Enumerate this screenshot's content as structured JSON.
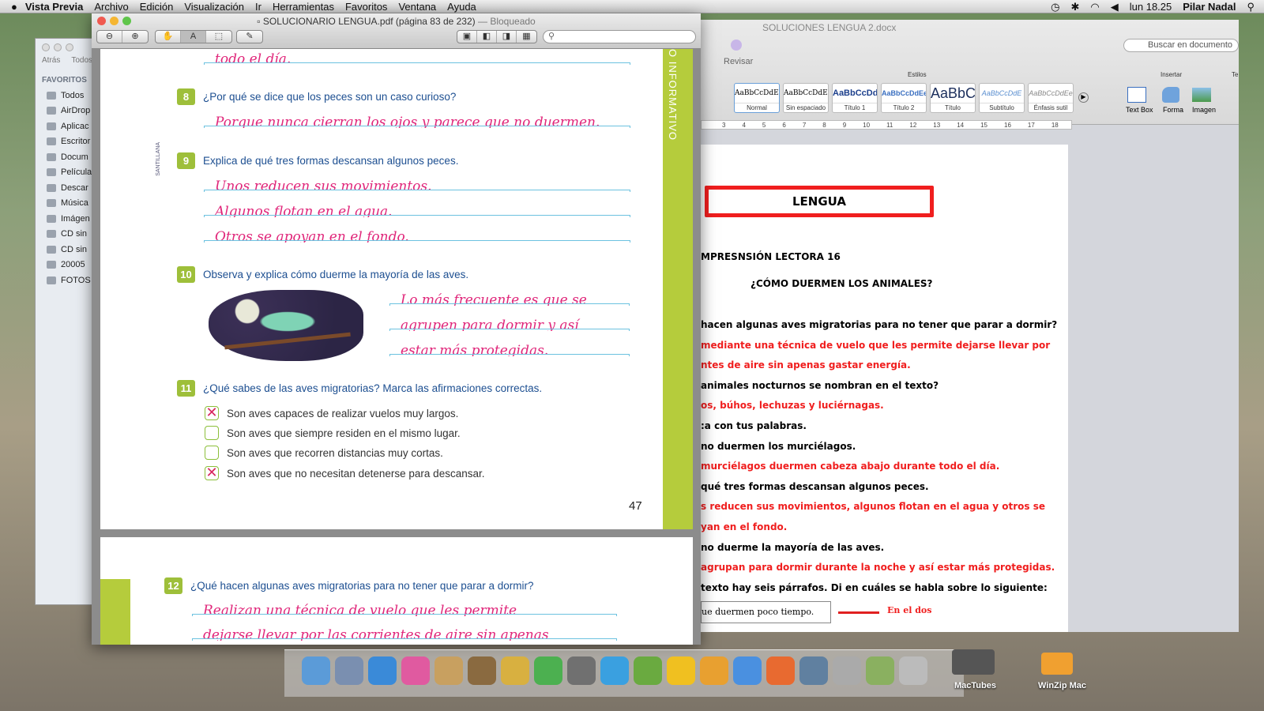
{
  "menubar": {
    "app": "Vista Previa",
    "items": [
      "Archivo",
      "Edición",
      "Visualización",
      "Ir",
      "Herramientas",
      "Favoritos",
      "Ventana",
      "Ayuda"
    ],
    "clock": "lun 18.25",
    "user": "Pilar Nadal"
  },
  "finder": {
    "back": "Atrás",
    "all": "Todos",
    "section": "FAVORITOS",
    "items": [
      "Todos",
      "AirDrop",
      "Aplicac",
      "Escritor",
      "Docum",
      "Película",
      "Descar",
      "Música",
      "Imágen",
      "CD sin",
      "CD sin",
      "20005",
      "FOTOS"
    ]
  },
  "preview": {
    "title": "SOLUCIONARIO LENGUA.pdf (página 83 de 232)",
    "locked": "— Bloqueado",
    "search_placeholder": "",
    "page_side": "SANTILLANA",
    "stripe": "O INFORMATIVO",
    "page_number": "47",
    "top_answer": "todo el día.",
    "q8": {
      "n": "8",
      "text": "¿Por qué se dice que los peces son un caso curioso?",
      "answers": [
        "Porque nunca cierran los ojos y parece que no duermen."
      ]
    },
    "q9": {
      "n": "9",
      "text": "Explica de qué tres formas descansan algunos peces.",
      "answers": [
        "Unos reducen sus movimientos.",
        "Algunos flotan en el agua.",
        "Otros se apoyan en el fondo."
      ]
    },
    "q10": {
      "n": "10",
      "text": "Observa y explica cómo duerme la mayoría de las aves.",
      "answers": [
        "Lo más frecuente es que se",
        "agrupen para dormir y así",
        "estar más protegidas."
      ]
    },
    "q11": {
      "n": "11",
      "text": "¿Qué sabes de las aves migratorias? Marca las afirmaciones correctas.",
      "options": [
        {
          "text": "Son aves capaces de realizar vuelos muy largos.",
          "checked": true
        },
        {
          "text": "Son aves que siempre residen en el mismo lugar.",
          "checked": false
        },
        {
          "text": "Son aves que recorren distancias muy cortas.",
          "checked": false
        },
        {
          "text": "Son aves que no necesitan detenerse para descansar.",
          "checked": true
        }
      ]
    },
    "q12": {
      "n": "12",
      "text": "¿Qué hacen algunas aves migratorias para no tener que parar a dormir?",
      "answers": [
        "Realizan una técnica de vuelo que les permite",
        "dejarse llevar por las corrientes de aire sin apenas"
      ]
    }
  },
  "word": {
    "title": "SOLUCIONES LENGUA 2.docx",
    "search_placeholder": "Buscar en documento",
    "tab": "Revisar",
    "group_styles": "Estilos",
    "group_insert": "Insertar",
    "group_te": "Te",
    "styles": [
      {
        "preview": "AaBbCcDdEe",
        "label": "Normal"
      },
      {
        "preview": "AaBbCcDdEe",
        "label": "Sin espaciado"
      },
      {
        "preview": "AaBbCcDd",
        "label": "Título 1"
      },
      {
        "preview": "AaBbCcDdEe",
        "label": "Título 2"
      },
      {
        "preview": "AaBbC",
        "label": "Título"
      },
      {
        "preview": "AaBbCcDdE",
        "label": "Subtítulo"
      },
      {
        "preview": "AaBbCcDdEe",
        "label": "Énfasis sutil"
      }
    ],
    "insert": [
      "Text Box",
      "Forma",
      "Imagen"
    ],
    "ruler": [
      "3",
      "4",
      "5",
      "6",
      "7",
      "8",
      "9",
      "10",
      "11",
      "12",
      "13",
      "14",
      "15",
      "16",
      "17",
      "18"
    ],
    "doc": {
      "heading": "LENGUA",
      "subtitle": "MPRESNSIÓN LECTORA 16",
      "title": "¿CÓMO DUERMEN LOS ANIMALES?",
      "lines": [
        {
          "t": " hacen algunas aves migratorias para no tener que parar a dormir?",
          "red": false
        },
        {
          "t": "mediante una técnica de vuelo que les permite dejarse llevar por",
          "red": true
        },
        {
          "t": "ntes de aire sin apenas gastar energía.",
          "red": true
        },
        {
          "t": " animales nocturnos se nombran en el texto?",
          "red": false
        },
        {
          "t": "os, búhos, lechuzas y luciérnagas.",
          "red": true
        },
        {
          "t": ":a con tus palabras.",
          "red": false
        },
        {
          "t": "no duermen los murciélagos.",
          "red": false
        },
        {
          "t": " murciélagos duermen cabeza abajo durante todo el día.",
          "red": true
        },
        {
          "t": "qué tres formas descansan algunos peces.",
          "red": false
        },
        {
          "t": "s reducen sus movimientos, algunos flotan en el agua y otros se",
          "red": true
        },
        {
          "t": "yan en el fondo.",
          "red": true
        },
        {
          "t": "no duerme la mayoría  de las aves.",
          "red": false
        },
        {
          "t": "agrupan para dormir durante la noche y así estar más protegidas.",
          "red": true
        },
        {
          "t": "texto hay seis párrafos. Di en cuáles se habla sobre lo siguiente:",
          "red": false
        }
      ],
      "box_text": "ue duermen poco tiempo.",
      "box_answer": "En el dos"
    }
  },
  "dock": {
    "labels": [
      "MacTubes",
      "WinZip Mac"
    ]
  },
  "colors": {
    "accent_green": "#b5cc3c",
    "answer_pink": "#e0267a",
    "word_red": "#f01e1e",
    "question_blue": "#1d4f91"
  }
}
